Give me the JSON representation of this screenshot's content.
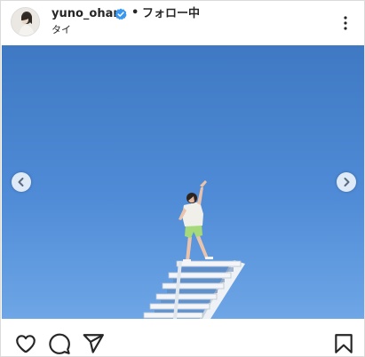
{
  "post": {
    "username": "yuno_ohara",
    "separator": "•",
    "follow_status": "フォロー中",
    "location": "タイ",
    "verified": true
  },
  "icons": {
    "avatar": "avatar-photo",
    "verified": "verified-badge-icon",
    "more": "more-options-icon",
    "prev": "chevron-left-icon",
    "next": "chevron-right-icon",
    "like": "heart-icon",
    "comment": "comment-icon",
    "share": "paper-plane-icon",
    "save": "bookmark-icon"
  },
  "colors": {
    "verified_blue": "#3897f0",
    "sky_top": "#3f79c4",
    "sky_bottom": "#6ea6e6",
    "text": "#262626"
  }
}
